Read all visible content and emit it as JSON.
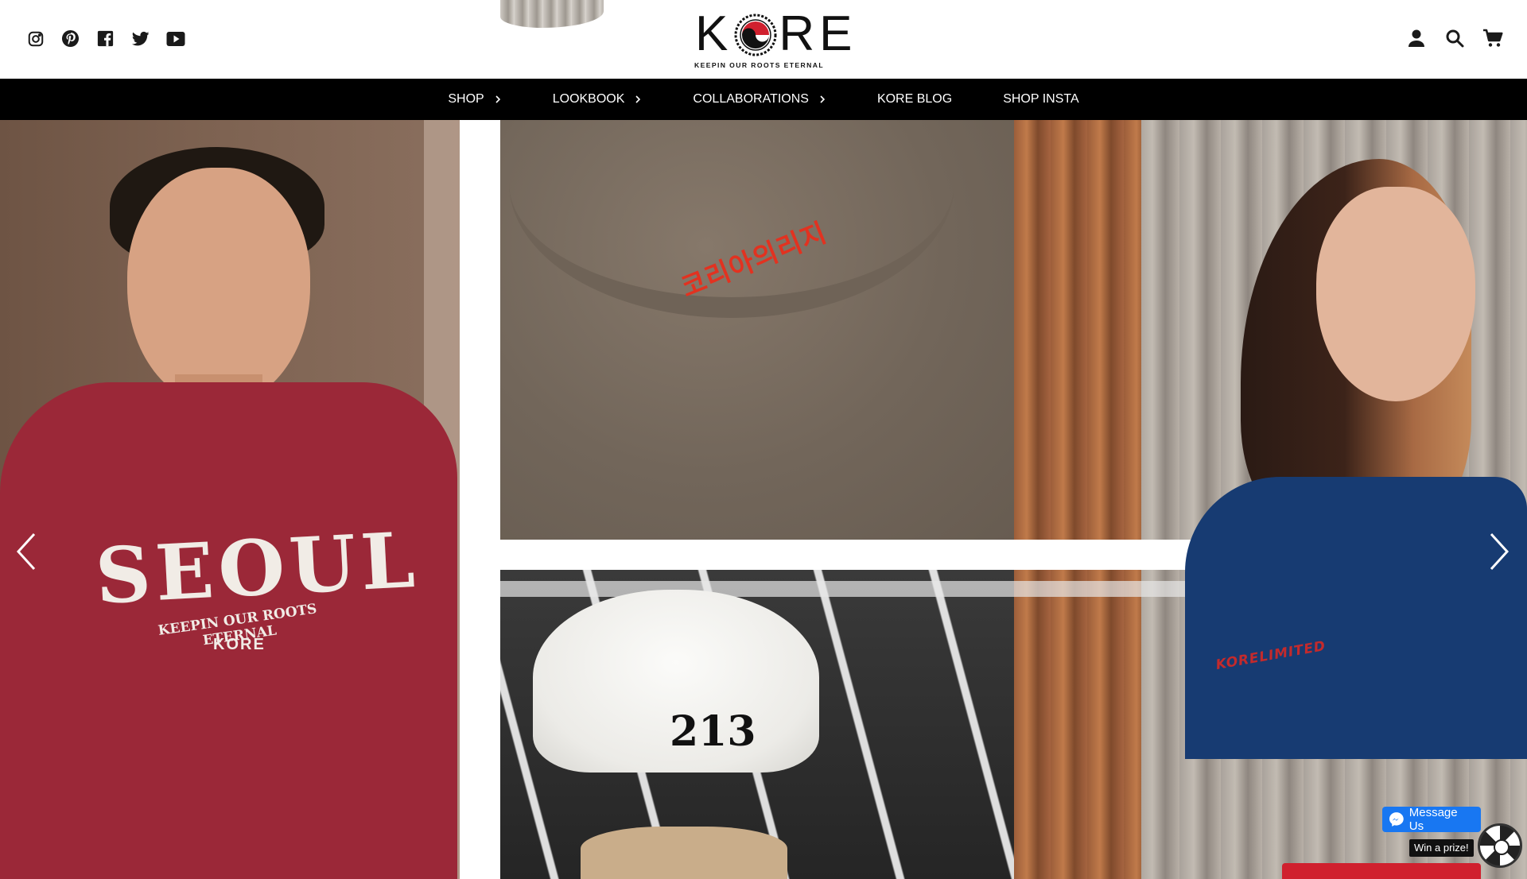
{
  "brand": {
    "name": "KORE",
    "name_left": "K",
    "name_right": "RE",
    "tagline": "KEEPIN OUR ROOTS ETERNAL"
  },
  "social": [
    {
      "name": "instagram-icon"
    },
    {
      "name": "pinterest-icon"
    },
    {
      "name": "facebook-icon"
    },
    {
      "name": "twitter-icon"
    },
    {
      "name": "youtube-icon"
    }
  ],
  "utility": [
    {
      "name": "account-icon"
    },
    {
      "name": "search-icon"
    },
    {
      "name": "cart-icon"
    }
  ],
  "nav": {
    "items": [
      {
        "label": "SHOP",
        "has_submenu": true
      },
      {
        "label": "LOOKBOOK",
        "has_submenu": true
      },
      {
        "label": "COLLABORATIONS",
        "has_submenu": true
      },
      {
        "label": "KORE BLOG",
        "has_submenu": false
      },
      {
        "label": "SHOP INSTA",
        "has_submenu": false
      }
    ]
  },
  "hero": {
    "tee_print": "SEOUL",
    "tee_print_sub": "KEEPIN OUR ROOTS ETERNAL",
    "tee_print_logo": "KORE",
    "collar_embroidery": "코리아의리지",
    "hat_print": "213",
    "sleeve_print": "KORELIMITED"
  },
  "messenger": {
    "button_label": "Message Us",
    "prize_label": "Win a prize!"
  },
  "colors": {
    "nav_bg": "#000000",
    "accent_red": "#d0202e",
    "messenger_blue": "#1877f2"
  }
}
